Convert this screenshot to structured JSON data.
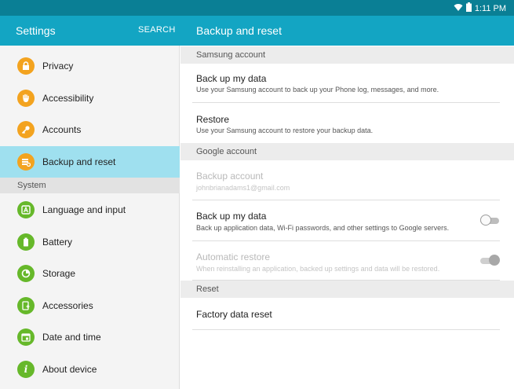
{
  "status_bar": {
    "time": "1:11 PM",
    "wifi_icon": "wifi-icon",
    "battery_icon": "battery-icon"
  },
  "app_bar": {
    "left_title": "Settings",
    "search_label": "SEARCH",
    "right_title": "Backup and reset"
  },
  "sidebar": {
    "items_top": [
      {
        "label": "Privacy",
        "icon": "privacy-icon",
        "color": "#f3a31f"
      },
      {
        "label": "Accessibility",
        "icon": "hand-icon",
        "color": "#f3a31f"
      },
      {
        "label": "Accounts",
        "icon": "key-icon",
        "color": "#f3a31f"
      },
      {
        "label": "Backup and reset",
        "icon": "backup-icon",
        "color": "#f3a31f",
        "selected": true
      }
    ],
    "section_label": "System",
    "items_system": [
      {
        "label": "Language and input",
        "icon": "language-icon",
        "color": "#66b82a"
      },
      {
        "label": "Battery",
        "icon": "battery-icon",
        "color": "#66b82a"
      },
      {
        "label": "Storage",
        "icon": "storage-icon",
        "color": "#66b82a"
      },
      {
        "label": "Accessories",
        "icon": "accessories-icon",
        "color": "#66b82a"
      },
      {
        "label": "Date and time",
        "icon": "calendar-icon",
        "color": "#66b82a"
      },
      {
        "label": "About device",
        "icon": "info-icon",
        "color": "#66b82a"
      }
    ]
  },
  "content": {
    "samsung_header": "Samsung account",
    "backup_samsung": {
      "title": "Back up my data",
      "subtitle": "Use your Samsung account to back up your Phone log, messages, and more."
    },
    "restore": {
      "title": "Restore",
      "subtitle": "Use your Samsung account to restore your backup data."
    },
    "google_header": "Google account",
    "backup_account": {
      "title": "Backup account",
      "subtitle": "johnbrianadams1@gmail.com",
      "enabled": false
    },
    "backup_google": {
      "title": "Back up my data",
      "subtitle": "Back up application data, Wi-Fi passwords, and other settings to Google servers.",
      "toggle": "off"
    },
    "auto_restore": {
      "title": "Automatic restore",
      "subtitle": "When reinstalling an application, backed up settings and data will be restored.",
      "toggle": "on",
      "enabled": false
    },
    "reset_header": "Reset",
    "factory_reset": {
      "title": "Factory data reset"
    }
  },
  "colors": {
    "status_bar": "#0a7f95",
    "app_bar": "#13a5c3",
    "selected_item": "#9fe0ef",
    "personal_icon": "#f3a31f",
    "system_icon": "#66b82a"
  }
}
